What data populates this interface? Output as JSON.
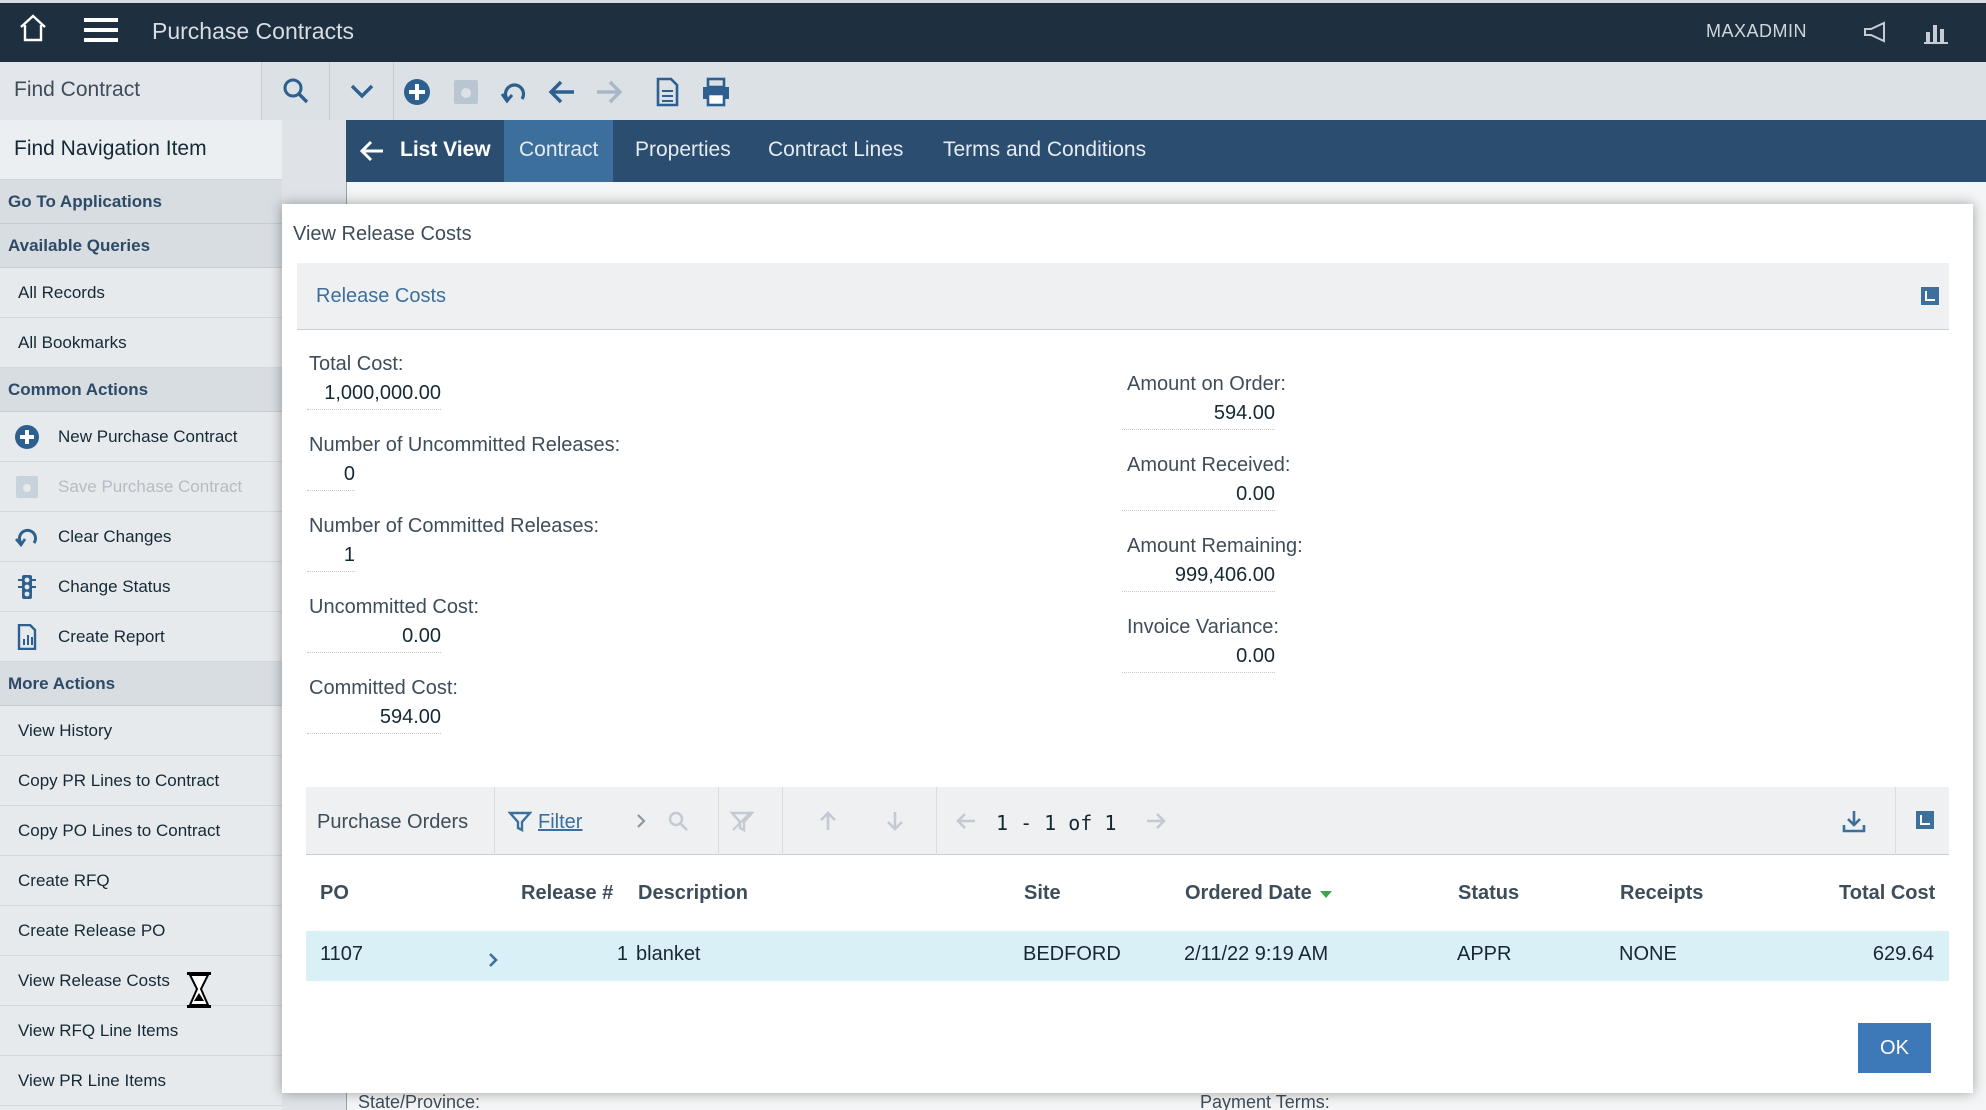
{
  "topbar": {
    "app_title": "Purchase Contracts",
    "user": "MAXADMIN"
  },
  "toolbar": {
    "find_contract": "Find Contract"
  },
  "leftnav": {
    "find_nav_item": "Find Navigation Item",
    "go_to_applications": "Go To Applications",
    "available_queries": "Available Queries",
    "queries": [
      "All Records",
      "All Bookmarks"
    ],
    "common_actions": "Common Actions",
    "common": [
      {
        "label": "New Purchase Contract",
        "icon": "add-icon"
      },
      {
        "label": "Save Purchase Contract",
        "icon": "save-icon",
        "disabled": true
      },
      {
        "label": "Clear Changes",
        "icon": "undo-icon"
      },
      {
        "label": "Change Status",
        "icon": "traffic-light-icon"
      },
      {
        "label": "Create Report",
        "icon": "report-icon"
      }
    ],
    "more_actions": "More Actions",
    "more": [
      "View History",
      "Copy PR Lines to Contract",
      "Copy PO Lines to Contract",
      "Create RFQ",
      "Create Release PO",
      "View Release Costs",
      "View RFQ Line Items",
      "View PR Line Items"
    ]
  },
  "tabs": {
    "list_view": "List View",
    "items": [
      "Contract",
      "Properties",
      "Contract Lines",
      "Terms and Conditions"
    ],
    "active": "Contract"
  },
  "background_fields": {
    "state_province": "State/Province:",
    "payment_terms": "Payment Terms:"
  },
  "modal": {
    "title": "View Release Costs",
    "section": "Release Costs",
    "left_fields": [
      {
        "label": "Total Cost:",
        "value": "1,000,000.00"
      },
      {
        "label": "Number of Uncommitted Releases:",
        "value": "0"
      },
      {
        "label": "Number of Committed Releases:",
        "value": "1"
      },
      {
        "label": "Uncommitted Cost:",
        "value": "0.00"
      },
      {
        "label": "Committed Cost:",
        "value": "594.00"
      }
    ],
    "right_fields": [
      {
        "label": "Amount on Order:",
        "value": "594.00"
      },
      {
        "label": "Amount Received:",
        "value": "0.00"
      },
      {
        "label": "Amount Remaining:",
        "value": "999,406.00"
      },
      {
        "label": "Invoice Variance:",
        "value": "0.00"
      }
    ],
    "po_table": {
      "title": "Purchase Orders",
      "filter": "Filter",
      "pager": "1 - 1 of 1",
      "columns": [
        "PO",
        "Release #",
        "Description",
        "Site",
        "Ordered Date",
        "Status",
        "Receipts",
        "Total Cost"
      ],
      "rows": [
        {
          "po": "1107",
          "release": "1",
          "description": "blanket",
          "site": "BEDFORD",
          "ordered_date": "2/11/22 9:19 AM",
          "status": "APPR",
          "receipts": "NONE",
          "total_cost": "629.64"
        }
      ]
    },
    "ok_label": "OK"
  },
  "colors": {
    "topbar": "#1e2f3f",
    "tabbar": "#2b4d6f",
    "active_tab": "#3d6f9d",
    "accent": "#3d78b8",
    "selected_row": "#daf0f7"
  }
}
